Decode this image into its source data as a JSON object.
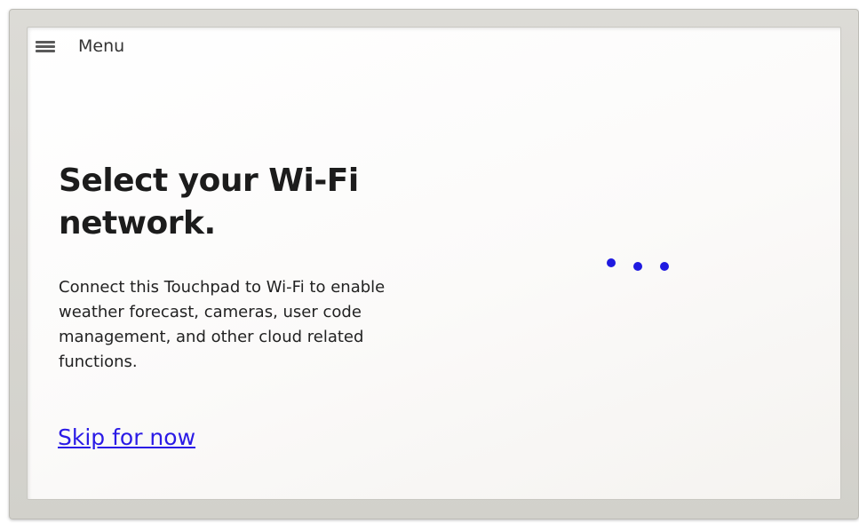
{
  "menu": {
    "label": "Menu",
    "icon": "hamburger-menu-icon"
  },
  "setup": {
    "title": "Select your Wi-Fi network.",
    "description": "Connect this Touchpad to Wi-Fi to enable weather forecast, cameras, user code management, and other cloud related functions.",
    "skip_label": "Skip for now"
  },
  "loading": {
    "icon": "loading-dots-icon",
    "dot_count": 3
  },
  "colors": {
    "accent": "#2a1ae6",
    "bezel": "#d6d5cf",
    "screen_background": "#fbfaf9",
    "text": "#1c1c1c"
  }
}
